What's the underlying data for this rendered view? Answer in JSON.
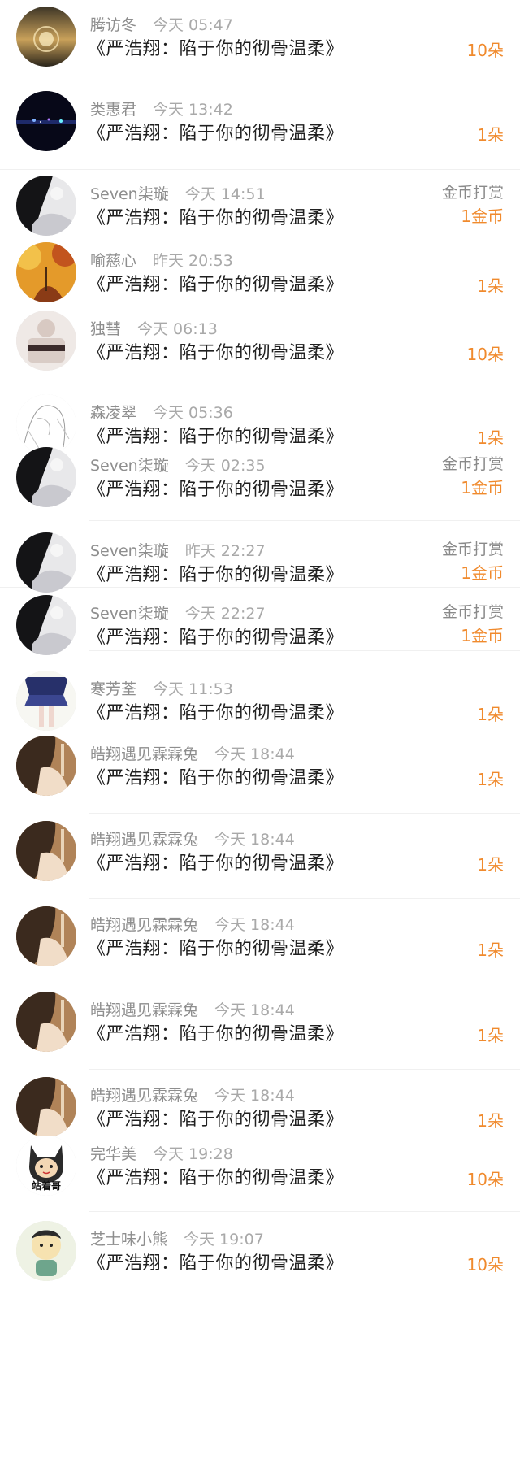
{
  "colors": {
    "accent": "#f08a2d",
    "name": "#8e8e8e",
    "title": "#202020"
  },
  "rows": [
    {
      "user": "腾访冬",
      "time": "今天 05:47",
      "title": "《严浩翔：陷于你的彻骨温柔》",
      "amount": "10朵",
      "kind": "",
      "avatar": "sunset-sphere"
    },
    {
      "user": "类惠君",
      "time": "今天 13:42",
      "title": "《严浩翔：陷于你的彻骨温柔》",
      "amount": "1朵",
      "kind": "",
      "avatar": "night-lights"
    },
    {
      "user": "Seven柒璇",
      "time": "今天 14:51",
      "title": "《严浩翔：陷于你的彻骨温柔》",
      "amount": "1金币",
      "kind": "金币打赏",
      "avatar": "dark-hair"
    },
    {
      "user": "喻慈心",
      "time": "昨天 20:53",
      "title": "《严浩翔：陷于你的彻骨温柔》",
      "amount": "1朵",
      "kind": "",
      "avatar": "autumn-trees"
    },
    {
      "user": "独彗",
      "time": "今天 06:13",
      "title": "《严浩翔：陷于你的彻骨温柔》",
      "amount": "10朵",
      "kind": "",
      "avatar": "person-light"
    },
    {
      "user": "森凌翠",
      "time": "今天 05:36",
      "title": "《严浩翔：陷于你的彻骨温柔》",
      "amount": "1朵",
      "kind": "",
      "avatar": "sketch"
    },
    {
      "user": "Seven柒璇",
      "time": "今天 02:35",
      "title": "《严浩翔：陷于你的彻骨温柔》",
      "amount": "1金币",
      "kind": "金币打赏",
      "avatar": "dark-hair"
    },
    {
      "user": "Seven柒璇",
      "time": "昨天 22:27",
      "title": "《严浩翔：陷于你的彻骨温柔》",
      "amount": "1金币",
      "kind": "金币打赏",
      "avatar": "dark-hair"
    },
    {
      "user": "Seven柒璇",
      "time": "今天 22:27",
      "title": "《严浩翔：陷于你的彻骨温柔》",
      "amount": "1金币",
      "kind": "金币打赏",
      "avatar": "dark-hair"
    },
    {
      "user": "寒芳荃",
      "time": "今天 11:53",
      "title": "《严浩翔：陷于你的彻骨温柔》",
      "amount": "1朵",
      "kind": "",
      "avatar": "skirt-girl"
    },
    {
      "user": "皓翔遇见霖霖兔",
      "time": "今天 18:44",
      "title": "《严浩翔：陷于你的彻骨温柔》",
      "amount": "1朵",
      "kind": "",
      "avatar": "brown-hair"
    },
    {
      "user": "皓翔遇见霖霖兔",
      "time": "今天 18:44",
      "title": "《严浩翔：陷于你的彻骨温柔》",
      "amount": "1朵",
      "kind": "",
      "avatar": "brown-hair"
    },
    {
      "user": "皓翔遇见霖霖兔",
      "time": "今天 18:44",
      "title": "《严浩翔：陷于你的彻骨温柔》",
      "amount": "1朵",
      "kind": "",
      "avatar": "brown-hair"
    },
    {
      "user": "皓翔遇见霖霖兔",
      "time": "今天 18:44",
      "title": "《严浩翔：陷于你的彻骨温柔》",
      "amount": "1朵",
      "kind": "",
      "avatar": "brown-hair"
    },
    {
      "user": "皓翔遇见霖霖兔",
      "time": "今天 18:44",
      "title": "《严浩翔：陷于你的彻骨温柔》",
      "amount": "1朵",
      "kind": "",
      "avatar": "brown-hair"
    },
    {
      "user": "完华美",
      "time": "今天 19:28",
      "title": "《严浩翔：陷于你的彻骨温柔》",
      "amount": "10朵",
      "kind": "",
      "avatar": "cat-sticker",
      "avatar_caption": "站着哥"
    },
    {
      "user": "芝士味小熊",
      "time": "今天 19:07",
      "title": "《严浩翔：陷于你的彻骨温柔》",
      "amount": "10朵",
      "kind": "",
      "avatar": "cartoon-kid"
    }
  ]
}
